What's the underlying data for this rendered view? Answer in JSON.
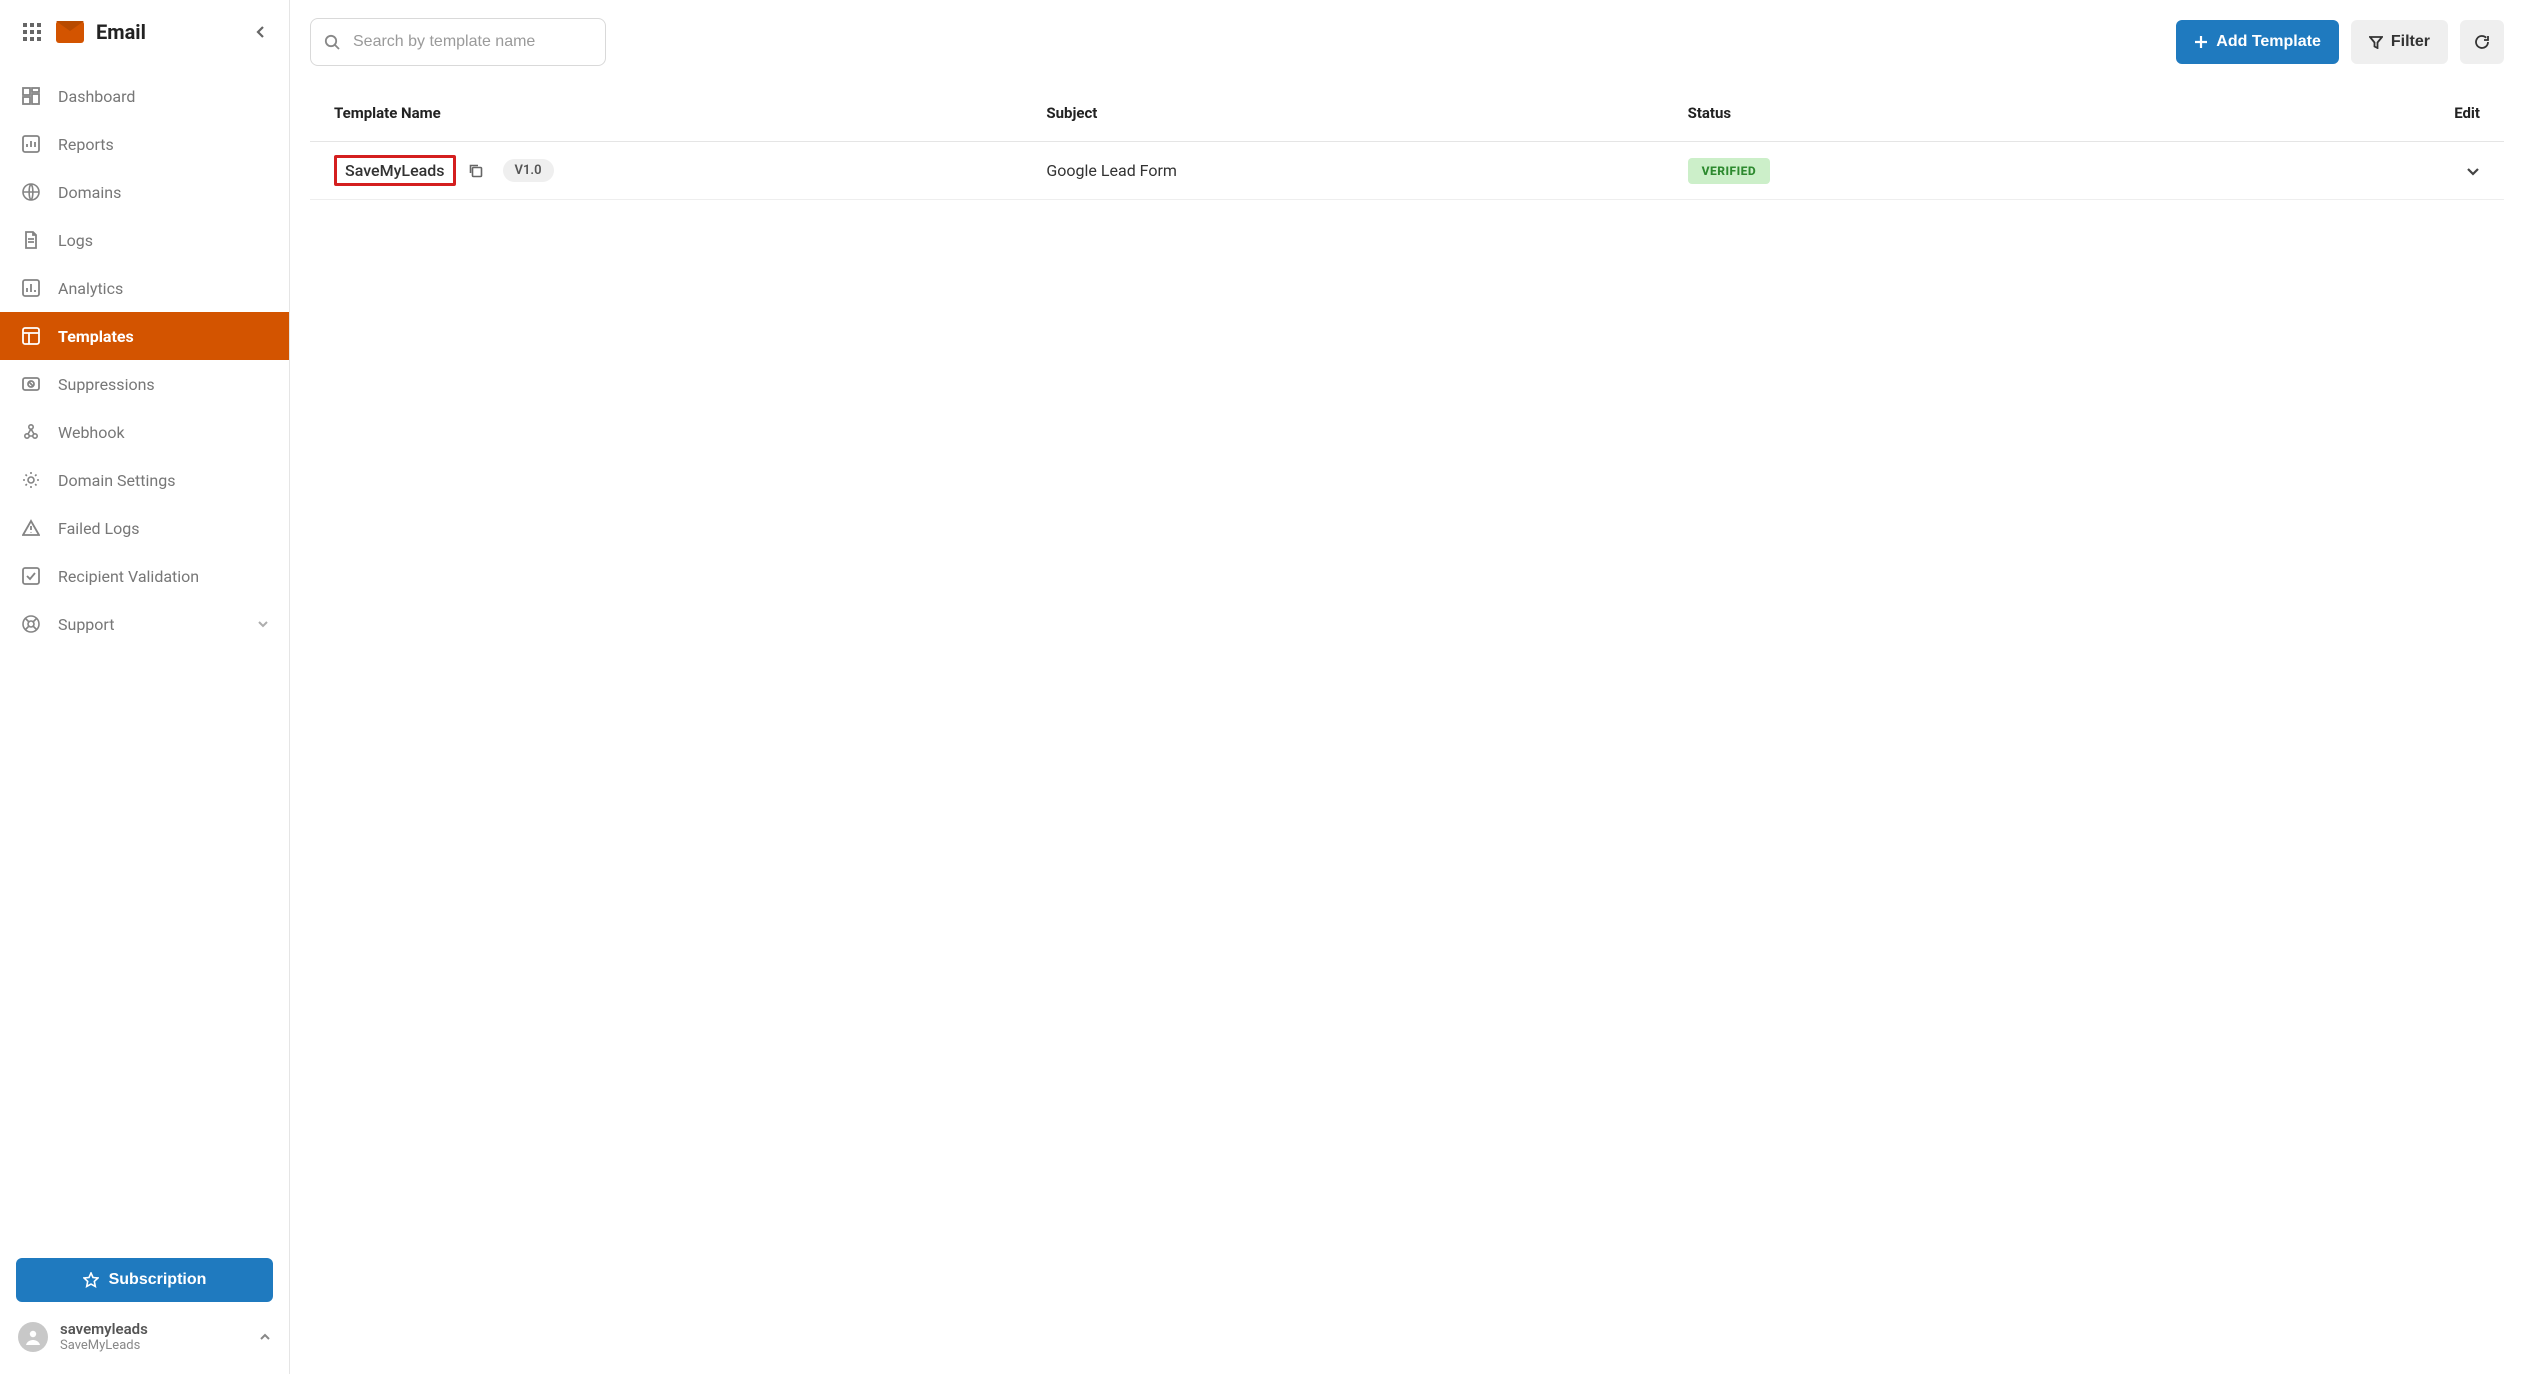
{
  "header": {
    "brand_label": "Email"
  },
  "sidebar": {
    "items": [
      {
        "label": "Dashboard",
        "icon": "dashboard-icon"
      },
      {
        "label": "Reports",
        "icon": "reports-icon"
      },
      {
        "label": "Domains",
        "icon": "domains-icon"
      },
      {
        "label": "Logs",
        "icon": "logs-icon"
      },
      {
        "label": "Analytics",
        "icon": "analytics-icon"
      },
      {
        "label": "Templates",
        "icon": "templates-icon",
        "active": true
      },
      {
        "label": "Suppressions",
        "icon": "suppressions-icon"
      },
      {
        "label": "Webhook",
        "icon": "webhook-icon"
      },
      {
        "label": "Domain Settings",
        "icon": "settings-icon"
      },
      {
        "label": "Failed Logs",
        "icon": "failed-logs-icon"
      },
      {
        "label": "Recipient Validation",
        "icon": "recipient-validation-icon"
      },
      {
        "label": "Support",
        "icon": "support-icon",
        "expandable": true
      }
    ],
    "subscription_label": "Subscription",
    "account": {
      "name": "savemyleads",
      "org": "SaveMyLeads"
    }
  },
  "toolbar": {
    "search_placeholder": "Search by template name",
    "add_template_label": "Add Template",
    "filter_label": "Filter"
  },
  "table": {
    "columns": {
      "template_name": "Template Name",
      "subject": "Subject",
      "status": "Status",
      "edit": "Edit"
    },
    "rows": [
      {
        "template_name": "SaveMyLeads",
        "version": "V1.0",
        "subject": "Google Lead Form",
        "status": "VERIFIED"
      }
    ]
  }
}
